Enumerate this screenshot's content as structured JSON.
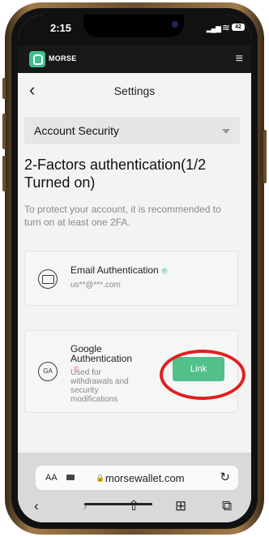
{
  "status_bar": {
    "time": "2:15",
    "battery": "42"
  },
  "app": {
    "brand": "MORSE"
  },
  "nav": {
    "title": "Settings"
  },
  "section_select": {
    "value": "Account Security"
  },
  "twofa": {
    "heading": "2-Factors authentication(1/2 Turned on)",
    "description": "To protect your account, it is recommended to turn on at least one 2FA."
  },
  "email_auth": {
    "title": "Email Authentication",
    "status": "enabled",
    "email": "us**@***.com"
  },
  "google_auth": {
    "title": "Google Authentication",
    "status": "not-enabled",
    "icon_text": "GA",
    "description": "Used for withdrawals and security modifications",
    "link_label": "Link"
  },
  "browser": {
    "aa_label": "AA",
    "url": "morsewallet.com"
  },
  "colors": {
    "accent": "#53c08a",
    "annotation": "#e01f1f",
    "header": "#181818"
  }
}
